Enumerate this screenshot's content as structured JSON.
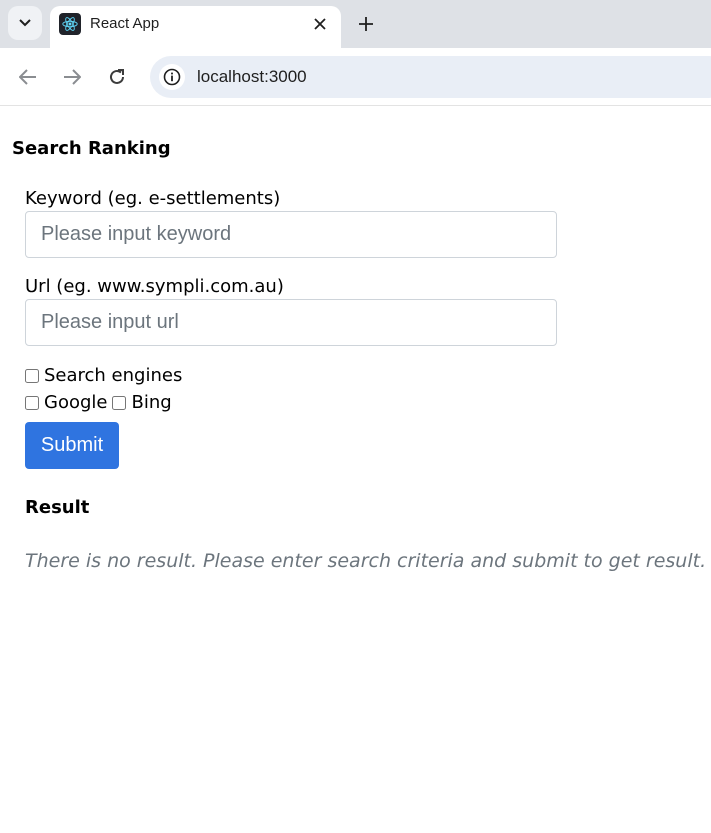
{
  "browser": {
    "tab_title": "React App",
    "address": "localhost:3000"
  },
  "page": {
    "title": "Search Ranking",
    "keyword": {
      "label": "Keyword (eg. e-settlements)",
      "value": "",
      "placeholder": "Please input keyword"
    },
    "url": {
      "label": "Url (eg. www.sympli.com.au)",
      "value": "",
      "placeholder": "Please input url"
    },
    "engines": {
      "group_label": "Search engines",
      "options": [
        "Google",
        "Bing"
      ]
    },
    "submit_label": "Submit",
    "result": {
      "title": "Result",
      "empty_message": "There is no result. Please enter search criteria and submit to get result."
    }
  }
}
